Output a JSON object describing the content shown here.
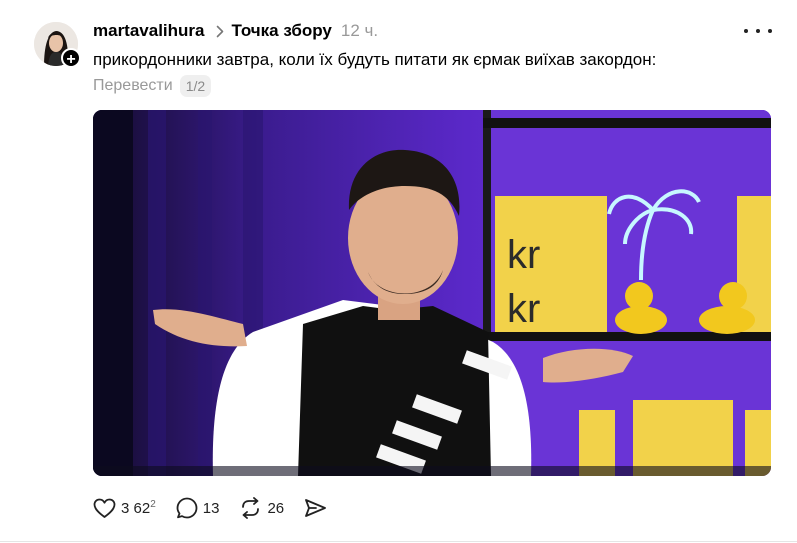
{
  "post": {
    "username": "martavalihura",
    "community": "Точка збору",
    "time": "12 ч.",
    "caption": "прикордонники завтра, коли їх будуть питати як єрмак виїхав закордон:",
    "translate_label": "Перевести",
    "page_indicator": "1/2"
  },
  "media": {
    "description_hidden": true,
    "logo_text": "kr kr"
  },
  "actions": {
    "likes": "3 62",
    "likes_suffix": "2",
    "comments": "13",
    "reposts": "26"
  },
  "colors": {
    "background": "#ffffff",
    "text": "#000000",
    "muted": "#999999",
    "media_accent": "#6b2fd6"
  },
  "icons": [
    "chevron-right-icon",
    "more-icon",
    "heart-icon",
    "comment-icon",
    "repost-icon",
    "share-icon",
    "plus-icon"
  ]
}
